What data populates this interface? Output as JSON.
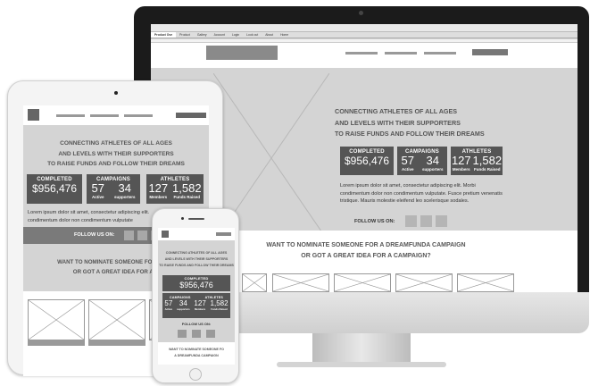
{
  "headline": {
    "line1": "CONNECTING ATHLETES OF ALL AGES",
    "line2": "AND LEVELS WITH THEIR SUPPORTERS",
    "line3": "TO RAISE FUNDS AND FOLLOW THEIR DREAMS"
  },
  "stats": {
    "completed_label": "COMPLETED",
    "completed_value": "$956,476",
    "campaigns_label": "CAMPAIGNS",
    "active_value": "57",
    "active_label": "Active",
    "supporters_value": "34",
    "supporters_label": "supporters",
    "athletes_label": "ATHLETES",
    "members_value": "127",
    "members_label": "Members",
    "funds_value": "1,582",
    "funds_label": "Funds Raised"
  },
  "lorem": {
    "desktop": "Lorem ipsum dolor sit amet, consectetur adipiscing elit. Morbi condimentum dolor non condimentum vulputate. Fusce pretium venenatis tristique. Mauris molestie eleifend leo scelerisque sodales.",
    "tablet_line1": "Lorem ipsum dolor sit amet, consectetur adipiscing elit.",
    "tablet_line2": "condimentum dolor non condimentum vulputate"
  },
  "follow_label": "FOLLOW US ON:",
  "nominate": {
    "desktop_line1": "WANT TO NOMINATE SOMEONE FOR A DREAMFUNDA CAMPAIGN",
    "desktop_line2": "OR GOT A GREAT IDEA FOR A CAMPAIGN?",
    "tablet_line1": "WANT TO NOMINATE SOMEONE FOR A DREA",
    "tablet_line2": "OR GOT A GREAT IDEA FOR A CA",
    "phone_line1": "WANT TO NOMINATE SOMEONE FO",
    "phone_line2": "A DREAMFUNDA CAMPAIGN"
  },
  "editor": {
    "tab_active": "Product Ove",
    "tabs": [
      "Product",
      "Gallery",
      "Account",
      "Login",
      "Look out",
      "About",
      "Home"
    ]
  },
  "colors": {
    "wireframe_bg": "#d4d4d4",
    "stat_bg": "#555555",
    "device_frame": "#f4f4f4",
    "monitor_bezel": "#1b1b1b"
  }
}
